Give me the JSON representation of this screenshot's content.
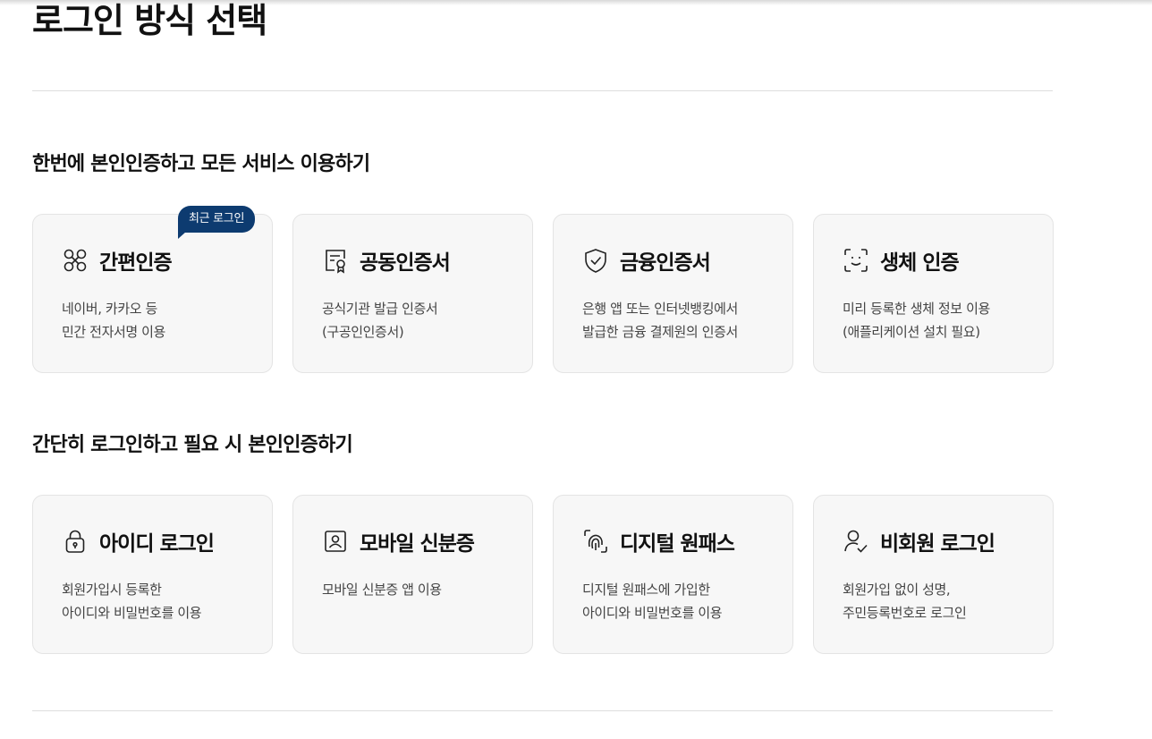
{
  "page": {
    "title": "로그인 방식 선택"
  },
  "sections": [
    {
      "title": "한번에 본인인증하고 모든 서비스 이용하기",
      "cards": [
        {
          "title": "간편인증",
          "icon": "nodes-icon",
          "desc": [
            "네이버, 카카오 등",
            "민간 전자서명 이용"
          ],
          "badge": "최근 로그인"
        },
        {
          "title": "공동인증서",
          "icon": "certificate-icon",
          "desc": [
            "공식기관 발급 인증서",
            "(구공인인증서)"
          ]
        },
        {
          "title": "금융인증서",
          "icon": "shield-check-icon",
          "desc": [
            "은행 앱 또는 인터넷뱅킹에서",
            "발급한 금융 결제원의 인증서"
          ]
        },
        {
          "title": "생체 인증",
          "icon": "face-scan-icon",
          "desc": [
            "미리 등록한 생체 정보 이용",
            "(애플리케이션 설치 필요)"
          ]
        }
      ]
    },
    {
      "title": "간단히 로그인하고 필요 시 본인인증하기",
      "cards": [
        {
          "title": "아이디 로그인",
          "icon": "lock-icon",
          "desc": [
            "회원가입시 등록한",
            "아이디와 비밀번호를 이용"
          ]
        },
        {
          "title": "모바일 신분증",
          "icon": "id-card-icon",
          "desc": [
            "모바일 신분증 앱 이용",
            ""
          ]
        },
        {
          "title": "디지털 원패스",
          "icon": "fingerprint-icon",
          "desc": [
            "디지털 원패스에 가입한",
            "아이디와 비밀번호를 이용"
          ]
        },
        {
          "title": "비회원 로그인",
          "icon": "user-check-icon",
          "desc": [
            "회원가입 없이 성명,",
            "주민등록번호로 로그인"
          ]
        }
      ]
    }
  ]
}
